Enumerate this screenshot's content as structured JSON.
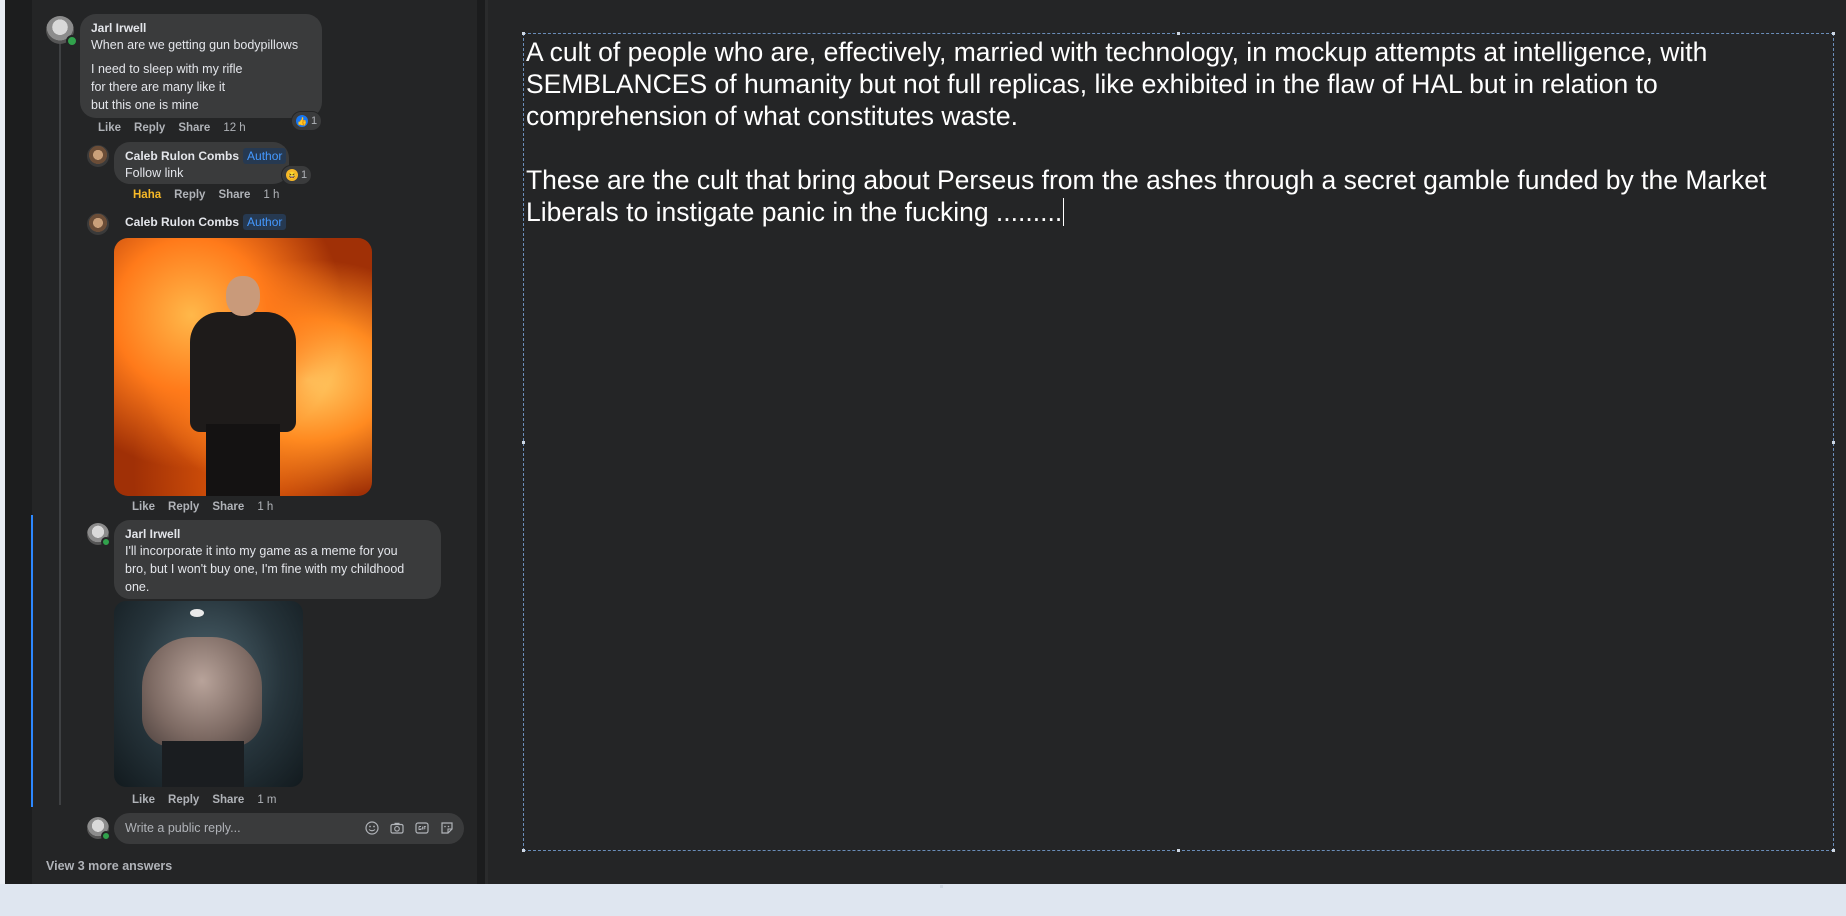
{
  "comments": [
    {
      "author": "Jarl Irwell",
      "lines": [
        "When are we getting gun bodypillows",
        "I need to sleep with my rifle",
        "for there are many like it",
        "but this one is mine"
      ],
      "actions": {
        "like": "Like",
        "reply": "Reply",
        "share": "Share",
        "time": "12 h"
      },
      "reaction_count": "1"
    },
    {
      "author": "Caleb Rulon Combs",
      "badge": "Author",
      "text": "Follow link",
      "actions": {
        "react": "Haha",
        "reply": "Reply",
        "share": "Share",
        "time": "1 h"
      },
      "reaction_count": "1"
    },
    {
      "author": "Caleb Rulon Combs",
      "badge": "Author",
      "actions": {
        "like": "Like",
        "reply": "Reply",
        "share": "Share",
        "time": "1 h"
      }
    },
    {
      "author": "Jarl Irwell",
      "lines": [
        "I'll incorporate it into my game as a meme for you",
        "bro, but I won't buy one, I'm fine with my childhood",
        "one."
      ],
      "actions": {
        "like": "Like",
        "reply": "Reply",
        "share": "Share",
        "time": "1 m"
      }
    }
  ],
  "reply_box": {
    "placeholder": "Write a public reply..."
  },
  "view_more": "View 3 more answers",
  "editor": {
    "paragraphs": [
      "A cult of people who are, effectively, married with technology, in mockup attempts at intelligence, with SEMBLANCES of humanity but not full replicas, like exhibited in the flaw of HAL but in relation to comprehension of what constitutes waste.",
      "These are the cult that bring about Perseus from the ashes through a secret gamble funded by the Market Liberals to instigate panic in the fucking ........."
    ]
  },
  "icons": {
    "reply_tools": [
      "emoji-icon",
      "camera-icon",
      "gif-icon",
      "sticker-icon"
    ]
  },
  "colors": {
    "accent": "#2d88ff",
    "haha": "#f7b928",
    "bubble": "#3a3b3c",
    "background": "#242526"
  }
}
